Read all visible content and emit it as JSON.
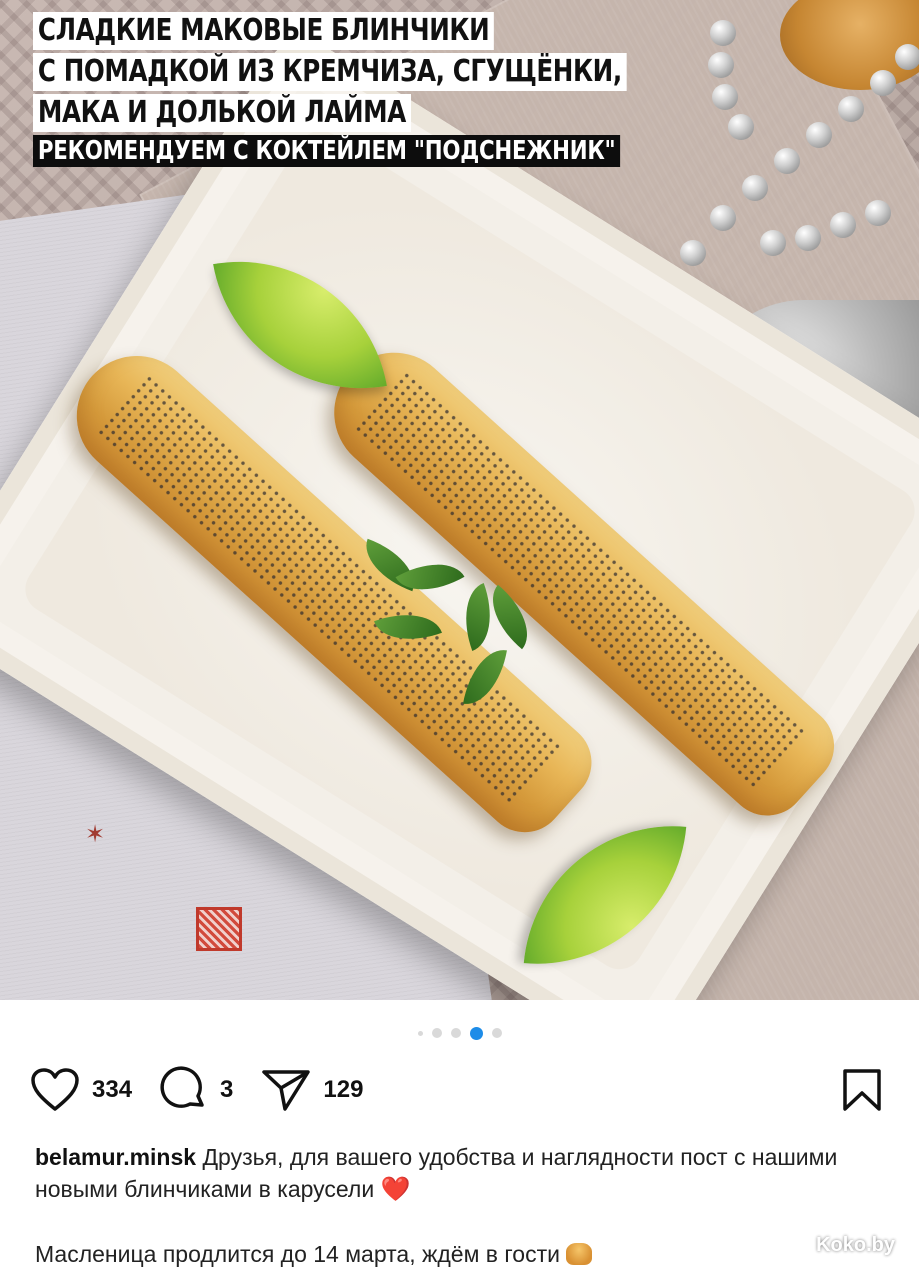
{
  "post": {
    "overlay": {
      "title_lines": [
        "СЛАДКИЕ МАКОВЫЕ БЛИНЧИКИ",
        "С ПОМАДКОЙ ИЗ КРЕМЧИЗА, СГУЩЁНКИ,",
        "МАКА И ДОЛЬКОЙ ЛАЙМА"
      ],
      "recommendation": "РЕКОМЕНДУЕМ С КОКТЕЙЛЕМ \"ПОДСНЕЖНИК\""
    },
    "carousel": {
      "total_dots": 5,
      "active_index": 3
    },
    "actions": {
      "likes": "334",
      "comments": "3",
      "shares": "129"
    },
    "caption": {
      "username": "belamur.minsk",
      "text": "Друзья, для вашего удобства и наглядности пост с нашими новыми блинчиками в карусели",
      "emoji_heart": "❤️",
      "second_line": "Масленица продлится до 14 марта, ждём в гости"
    },
    "watermark": "Koko.by",
    "icons": [
      "heart-icon",
      "comment-icon",
      "share-icon",
      "bookmark-icon"
    ],
    "colors": {
      "active_dot": "#1d8ce8",
      "text": "#111111"
    }
  }
}
